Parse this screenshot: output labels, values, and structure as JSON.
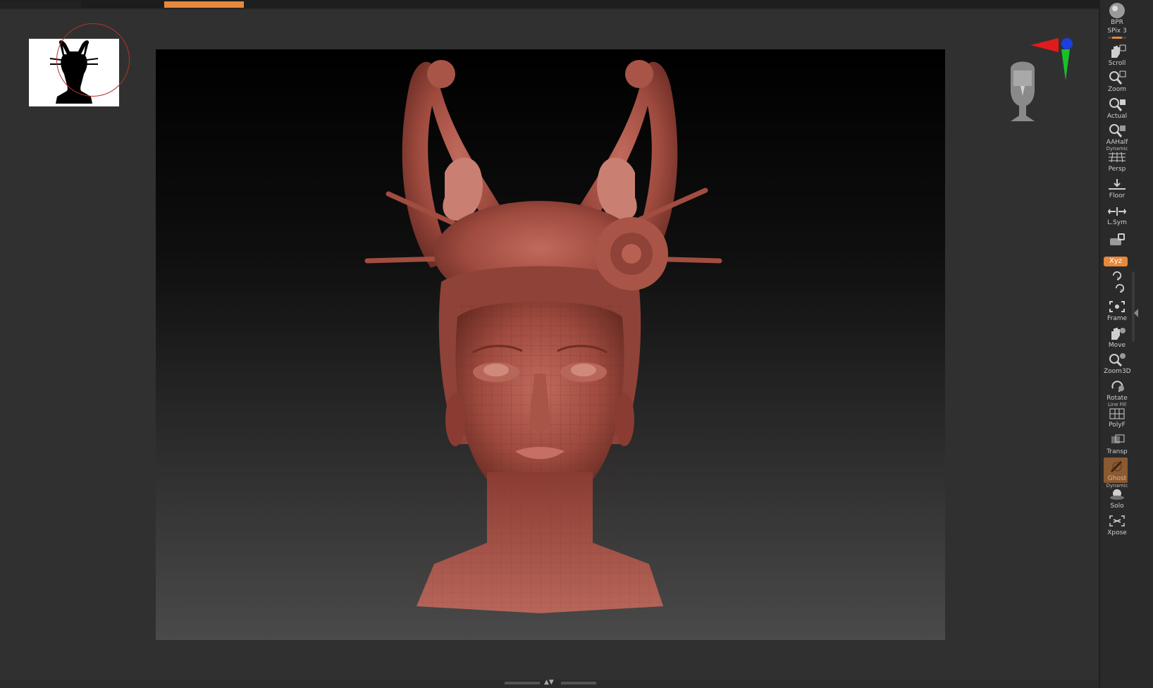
{
  "app": {
    "accent_color": "#e8883a",
    "model_color": "#9e4a3e"
  },
  "thumbnail": {
    "icon": "silhouette-icon"
  },
  "shelf": {
    "tools": [
      {
        "label": "BPR",
        "icon": "sphere-icon"
      },
      {
        "label": "SPix 3",
        "icon": "spix-slider-icon",
        "value": 3
      },
      {
        "label": "Scroll",
        "icon": "hand-scroll-icon"
      },
      {
        "label": "Zoom",
        "icon": "zoom-icon"
      },
      {
        "label": "Actual",
        "icon": "actual-size-icon"
      },
      {
        "label": "AAHalf",
        "icon": "aahalf-icon"
      },
      {
        "label": "Persp",
        "icon": "perspective-icon",
        "overlay": "Dynamic"
      },
      {
        "label": "Floor",
        "icon": "floor-grid-icon"
      },
      {
        "label": "L.Sym",
        "icon": "local-symmetry-icon"
      },
      {
        "label": "",
        "icon": "lock-camera-icon"
      },
      {
        "label": "Xyz",
        "icon": "xyz-rotate-icon"
      },
      {
        "label": "",
        "icon": "y-rotate-icon"
      },
      {
        "label": "",
        "icon": "z-rotate-icon"
      },
      {
        "label": "Frame",
        "icon": "frame-icon"
      },
      {
        "label": "Move",
        "icon": "move-hand-icon"
      },
      {
        "label": "Zoom3D",
        "icon": "zoom3d-icon"
      },
      {
        "label": "Rotate",
        "icon": "rotate-icon"
      },
      {
        "label": "PolyF",
        "icon": "polyframe-icon",
        "overlay": "Line Fill"
      },
      {
        "label": "Transp",
        "icon": "transparency-icon"
      },
      {
        "label": "Ghost",
        "icon": "ghost-icon"
      },
      {
        "label": "Solo",
        "icon": "solo-icon",
        "overlay": "Dynamic"
      },
      {
        "label": "Xpose",
        "icon": "xpose-icon"
      }
    ]
  }
}
